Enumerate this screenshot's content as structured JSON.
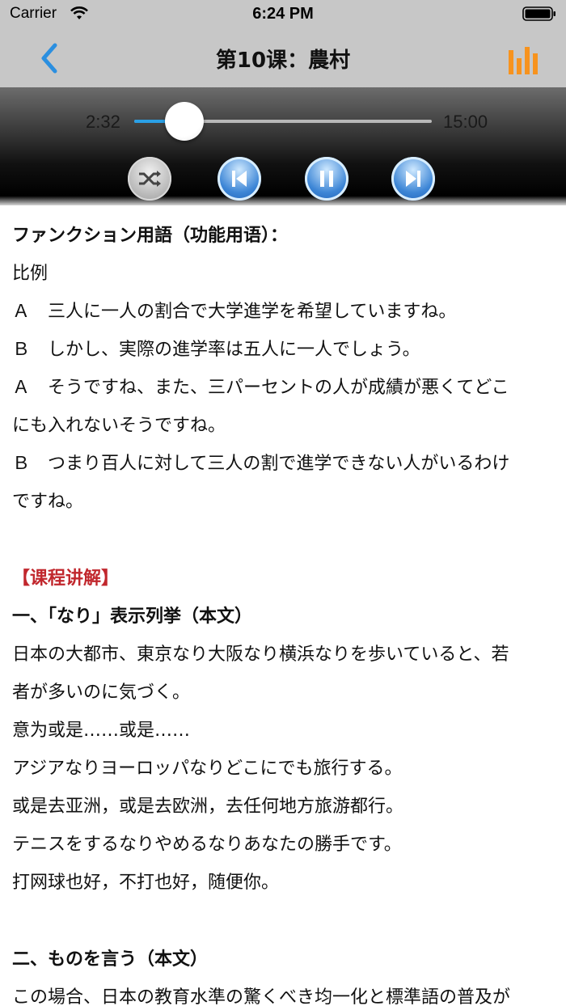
{
  "status_bar": {
    "carrier": "Carrier",
    "time": "6:24 PM",
    "icons": [
      "wifi-icon",
      "battery-icon"
    ]
  },
  "nav": {
    "title": "第10课：農村",
    "back_icon": "chevron-left-icon",
    "right_icon": "equalizer-icon",
    "accent_color": "#2b8fe0",
    "equalizer_color": "#f7931e"
  },
  "player": {
    "elapsed": "2:32",
    "total": "15:00",
    "progress": 0.169,
    "controls": [
      "shuffle-icon",
      "previous-icon",
      "pause-icon",
      "next-icon"
    ]
  },
  "content": {
    "lines": [
      "ファンクション用語（功能用语）：",
      "比例",
      "Ａ　三人に一人の割合で大学進学を希望していますね。",
      "Ｂ　しかし、実際の進学率は五人に一人でしょう。",
      "Ａ　そうですね、また、三パーセントの人が成績が悪くてどこ",
      "にも入れないそうですね。",
      "Ｂ　つまり百人に対して三人の割で進学できない人がいるわけ",
      "ですね。",
      "",
      "【课程讲解】",
      "一、「なり」表示列挙（本文）",
      "日本の大都市、東京なり大阪なり横浜なりを歩いていると、若",
      "者が多いのに気づく。",
      "意为或是……或是……",
      "アジアなりヨーロッパなりどこにでも旅行する。",
      "或是去亚洲，或是去欧洲，去任何地方旅游都行。",
      "テニスをするなりやめるなりあなたの勝手です。",
      "打网球也好，不打也好，随便你。",
      "",
      "二、ものを言う（本文）",
      "この場合、日本の教育水準の驚くべき均一化と標準語の普及が"
    ]
  }
}
